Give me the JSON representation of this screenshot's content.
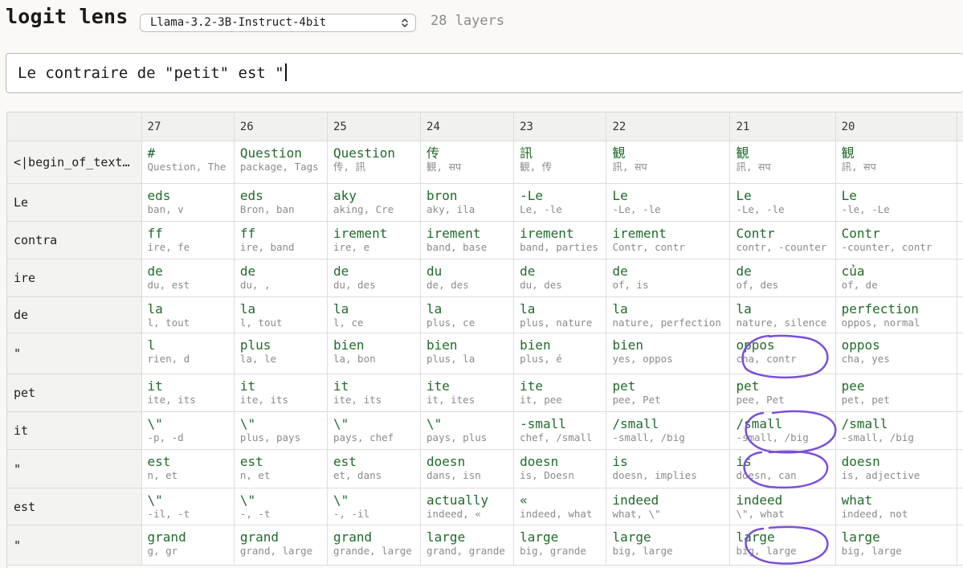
{
  "header": {
    "title": "logit lens",
    "model": "Llama-3.2-3B-Instruct-4bit",
    "layers_label": "28 layers"
  },
  "prompt": {
    "value": "Le contraire de \"petit\" est \""
  },
  "table": {
    "columns": [
      "27",
      "26",
      "25",
      "24",
      "23",
      "22",
      "21",
      "20"
    ],
    "rows": [
      {
        "token": "<|begin_of_text…",
        "cells": [
          {
            "top": "#",
            "alts": "Question, The"
          },
          {
            "top": "Question",
            "alts": "package, Tags"
          },
          {
            "top": "Question",
            "alts": "传, 訊"
          },
          {
            "top": "传",
            "alts": "観, सप"
          },
          {
            "top": "訊",
            "alts": "観, 传"
          },
          {
            "top": "観",
            "alts": "訊, सप"
          },
          {
            "top": "観",
            "alts": "訊, सप"
          },
          {
            "top": "観",
            "alts": "訊, सप"
          }
        ]
      },
      {
        "token": "Le",
        "cells": [
          {
            "top": "eds",
            "alts": "ban, v"
          },
          {
            "top": "eds",
            "alts": "Bron, ban"
          },
          {
            "top": "aky",
            "alts": "aking, Cre"
          },
          {
            "top": "bron",
            "alts": "aky, ila"
          },
          {
            "top": "-Le",
            "alts": "Le, -le"
          },
          {
            "top": "Le",
            "alts": "-Le, -le"
          },
          {
            "top": "Le",
            "alts": "-Le, -le"
          },
          {
            "top": "Le",
            "alts": "-le, -Le"
          }
        ]
      },
      {
        "token": "contra",
        "cells": [
          {
            "top": "ff",
            "alts": "ire, fe"
          },
          {
            "top": "ff",
            "alts": "ire, band"
          },
          {
            "top": "irement",
            "alts": "ire, e"
          },
          {
            "top": "irement",
            "alts": "band, base"
          },
          {
            "top": "irement",
            "alts": "band, parties"
          },
          {
            "top": "irement",
            "alts": "Contr, contr"
          },
          {
            "top": "Contr",
            "alts": "contr, -counter"
          },
          {
            "top": "Contr",
            "alts": "-counter, contr"
          }
        ]
      },
      {
        "token": "ire",
        "cells": [
          {
            "top": "de",
            "alts": "du, est"
          },
          {
            "top": "de",
            "alts": "du, ,"
          },
          {
            "top": "de",
            "alts": "du, des"
          },
          {
            "top": "du",
            "alts": "de, des"
          },
          {
            "top": "de",
            "alts": "du, des"
          },
          {
            "top": "de",
            "alts": "of, is"
          },
          {
            "top": "de",
            "alts": "of, des"
          },
          {
            "top": "của",
            "alts": "of, de"
          }
        ]
      },
      {
        "token": "de",
        "cells": [
          {
            "top": "la",
            "alts": "l, tout"
          },
          {
            "top": "la",
            "alts": "l, tout"
          },
          {
            "top": "la",
            "alts": "l, ce"
          },
          {
            "top": "la",
            "alts": "plus, ce"
          },
          {
            "top": "la",
            "alts": "plus, nature"
          },
          {
            "top": "la",
            "alts": "nature, perfection"
          },
          {
            "top": "la",
            "alts": "nature, silence"
          },
          {
            "top": "perfection",
            "alts": "oppos, normal"
          }
        ]
      },
      {
        "token": "\"",
        "cells": [
          {
            "top": "l",
            "alts": "rien, d"
          },
          {
            "top": "plus",
            "alts": "la, le"
          },
          {
            "top": "bien",
            "alts": "la, bon"
          },
          {
            "top": "bien",
            "alts": "plus, la"
          },
          {
            "top": "bien",
            "alts": "plus, é"
          },
          {
            "top": "bien",
            "alts": "yes, oppos"
          },
          {
            "top": "oppos",
            "alts": "cha, contr"
          },
          {
            "top": "oppos",
            "alts": "cha, yes"
          }
        ]
      },
      {
        "token": "pet",
        "cells": [
          {
            "top": "it",
            "alts": "ite, its"
          },
          {
            "top": "it",
            "alts": "ite, its"
          },
          {
            "top": "it",
            "alts": "ite, its"
          },
          {
            "top": "ite",
            "alts": "it, ites"
          },
          {
            "top": "ite",
            "alts": "it, pee"
          },
          {
            "top": "pet",
            "alts": "pee, Pet"
          },
          {
            "top": "pet",
            "alts": "pee, Pet"
          },
          {
            "top": "pee",
            "alts": "pet, pet"
          }
        ]
      },
      {
        "token": "it",
        "cells": [
          {
            "top": "\\\"",
            "alts": "-p, -d"
          },
          {
            "top": "\\\"",
            "alts": "plus, pays"
          },
          {
            "top": "\\\"",
            "alts": "pays, chef"
          },
          {
            "top": "\\\"",
            "alts": "pays, plus"
          },
          {
            "top": "-small",
            "alts": "chef, /small"
          },
          {
            "top": "/small",
            "alts": "-small, /big"
          },
          {
            "top": "/small",
            "alts": "-small, /big"
          },
          {
            "top": "/small",
            "alts": "-small, /big"
          }
        ]
      },
      {
        "token": "\"",
        "cells": [
          {
            "top": "est",
            "alts": "n, et"
          },
          {
            "top": "est",
            "alts": "n, et"
          },
          {
            "top": "est",
            "alts": "et, dans"
          },
          {
            "top": "doesn",
            "alts": "dans, isn"
          },
          {
            "top": "doesn",
            "alts": "is, Doesn"
          },
          {
            "top": "is",
            "alts": "doesn, implies"
          },
          {
            "top": "is",
            "alts": "doesn, can"
          },
          {
            "top": "doesn",
            "alts": "is, adjective"
          }
        ]
      },
      {
        "token": "est",
        "cells": [
          {
            "top": "\\\"",
            "alts": "-il, -t"
          },
          {
            "top": "\\\"",
            "alts": "-, -t"
          },
          {
            "top": "\\\"",
            "alts": "-, -il"
          },
          {
            "top": "actually",
            "alts": "indeed, «"
          },
          {
            "top": "«",
            "alts": "indeed, what"
          },
          {
            "top": "indeed",
            "alts": "what, \\\""
          },
          {
            "top": "indeed",
            "alts": "\\\", what"
          },
          {
            "top": "what",
            "alts": "indeed, not"
          }
        ]
      },
      {
        "token": "\"",
        "cells": [
          {
            "top": "grand",
            "alts": "g, gr"
          },
          {
            "top": "grand",
            "alts": "grand, large"
          },
          {
            "top": "grand",
            "alts": "grande, large"
          },
          {
            "top": "large",
            "alts": "grand, grande"
          },
          {
            "top": "large",
            "alts": "big, grande"
          },
          {
            "top": "large",
            "alts": "big, large"
          },
          {
            "top": "large",
            "alts": "big, large"
          },
          {
            "top": "large",
            "alts": "big, large"
          }
        ]
      }
    ]
  },
  "annotations": {
    "circle_color": "#7b4fd8"
  }
}
